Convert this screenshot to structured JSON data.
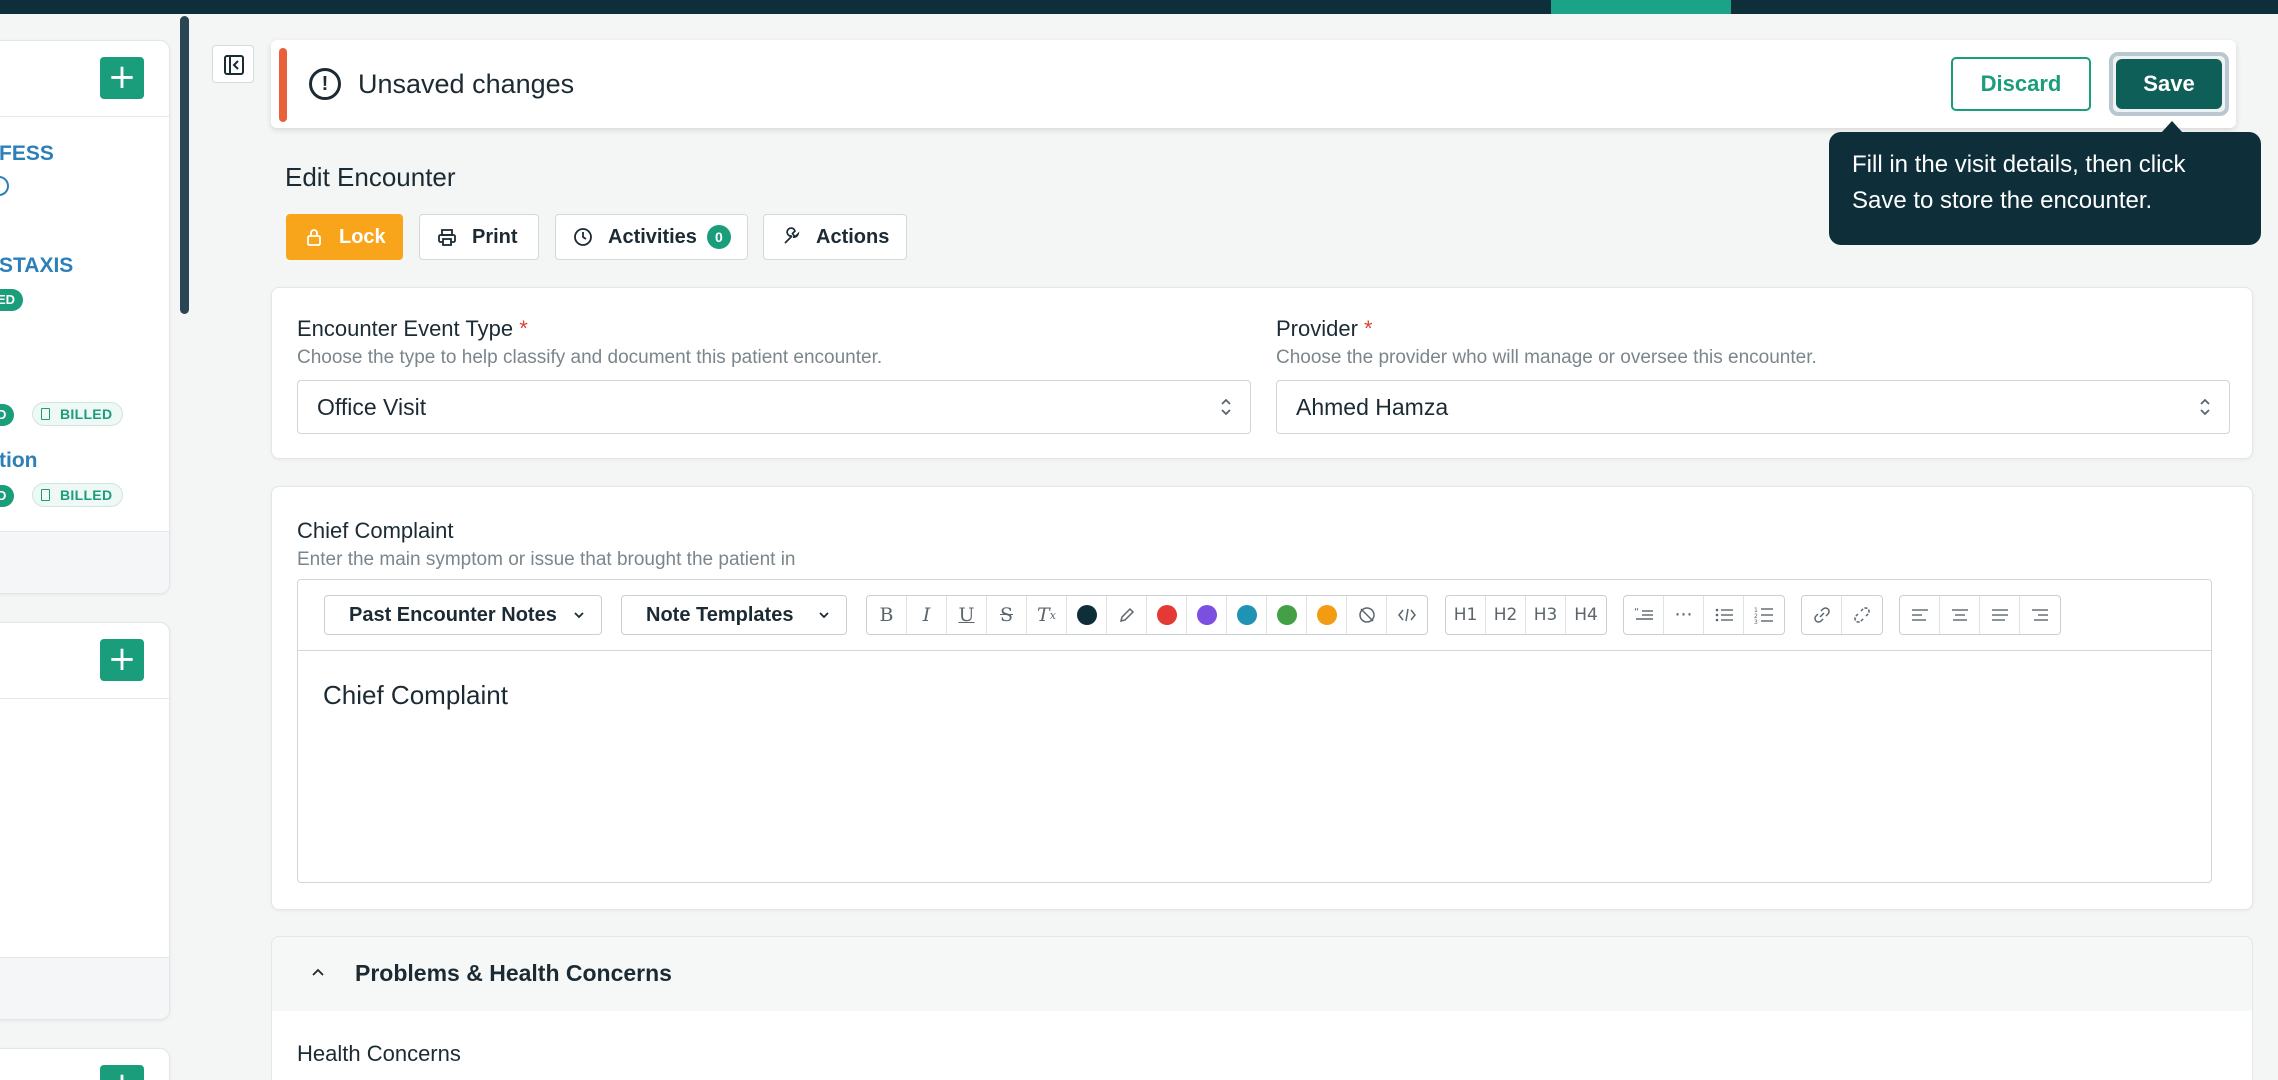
{
  "colors": {
    "accent": "#1a9d7b",
    "navy": "#0e2f3a",
    "warning_edge": "#e8613a",
    "lock": "#f8a51c",
    "link_blue": "#2c7fb8",
    "required": "#e0412f"
  },
  "sidebar": {
    "items": [
      {
        "label": "FESS"
      },
      {
        "label": "STAXIS",
        "badge": "ED"
      },
      {
        "badge": "D",
        "billed": "BILLED"
      },
      {
        "label": "tion",
        "badge": "D",
        "billed": "BILLED"
      }
    ]
  },
  "unsaved": {
    "message": "Unsaved changes",
    "discard_label": "Discard",
    "save_label": "Save"
  },
  "tooltip": {
    "text": "Fill in the visit details, then click Save to store the encounter."
  },
  "page": {
    "title": "Edit Encounter"
  },
  "actions": {
    "lock": "Lock",
    "print": "Print",
    "activities": "Activities",
    "activities_count": "0",
    "actions": "Actions"
  },
  "encounter": {
    "event_type_label": "Encounter Event Type",
    "event_type_help": "Choose the type to help classify and document this patient encounter.",
    "event_type_value": "Office Visit",
    "provider_label": "Provider",
    "provider_help": "Choose the provider who will manage or oversee this encounter.",
    "provider_value": "Ahmed Hamza",
    "required_mark": "*"
  },
  "chief_complaint": {
    "label": "Chief Complaint",
    "help": "Enter the main symptom or issue that brought the patient in",
    "past_notes": "Past Encounter Notes",
    "templates": "Note Templates",
    "body": "Chief Complaint",
    "toolbar_colors": [
      "#0e2f3a",
      "#e53935",
      "#7b4fe0",
      "#1e93b4",
      "#43a047",
      "#f39c12"
    ],
    "headings": [
      "H1",
      "H2",
      "H3",
      "H4"
    ]
  },
  "problems": {
    "title": "Problems & Health Concerns",
    "health_concerns_label": "Health Concerns"
  }
}
